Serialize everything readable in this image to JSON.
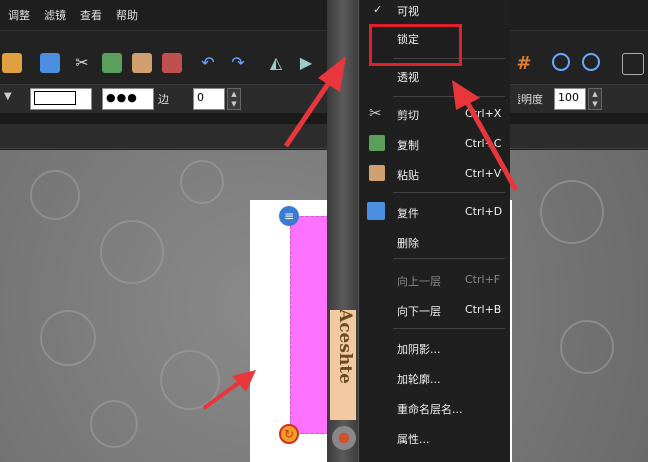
{
  "menubar": {
    "items": [
      "调整",
      "滤镜",
      "查看",
      "帮助"
    ]
  },
  "propbar": {
    "edge_label": "边",
    "edge_value": "0",
    "opacity_label": "透明度",
    "opacity_value": "100"
  },
  "context_menu": {
    "items": [
      {
        "label": "可视",
        "shortcut": "",
        "checked": true,
        "disabled": false
      },
      {
        "label": "锁定",
        "shortcut": "",
        "checked": false,
        "disabled": false
      },
      {
        "label": "透视",
        "shortcut": "",
        "checked": false,
        "disabled": false
      },
      {
        "label": "剪切",
        "shortcut": "Ctrl+X",
        "checked": false,
        "disabled": false
      },
      {
        "label": "复制",
        "shortcut": "Ctrl+C",
        "checked": false,
        "disabled": false
      },
      {
        "label": "粘贴",
        "shortcut": "Ctrl+V",
        "checked": false,
        "disabled": false
      },
      {
        "label": "复件",
        "shortcut": "Ctrl+D",
        "checked": false,
        "disabled": false
      },
      {
        "label": "删除",
        "shortcut": "",
        "checked": false,
        "disabled": false
      },
      {
        "label": "向上一层",
        "shortcut": "Ctrl+F",
        "checked": false,
        "disabled": true
      },
      {
        "label": "向下一层",
        "shortcut": "Ctrl+B",
        "checked": false,
        "disabled": false
      },
      {
        "label": "加阴影...",
        "shortcut": "",
        "checked": false,
        "disabled": false
      },
      {
        "label": "加轮廓...",
        "shortcut": "",
        "checked": false,
        "disabled": false
      },
      {
        "label": "重命名层名...",
        "shortcut": "",
        "checked": false,
        "disabled": false
      },
      {
        "label": "属性...",
        "shortcut": "",
        "checked": false,
        "disabled": false
      }
    ]
  },
  "canvas": {
    "vertical_text": "Aceshte"
  },
  "colors": {
    "highlight_box": "#e0202a",
    "arrow": "#e8363c",
    "layer_fill": "#ff72ff"
  }
}
